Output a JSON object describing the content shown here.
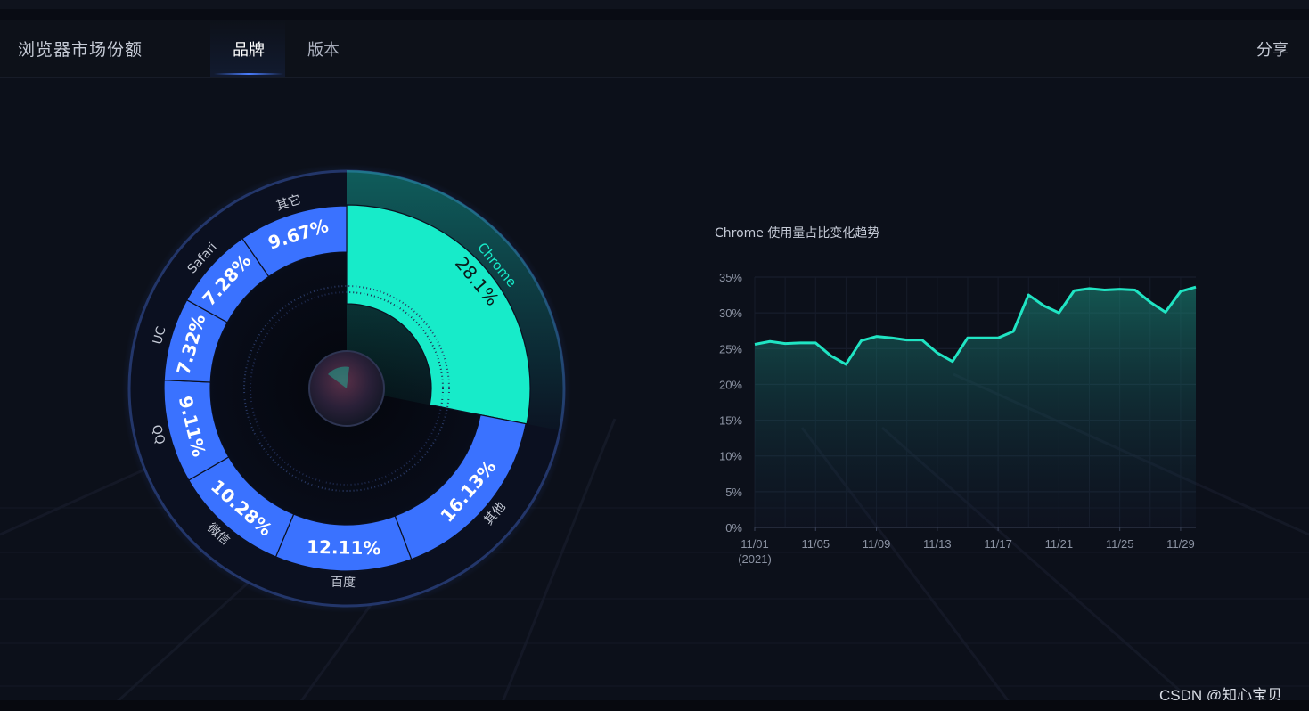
{
  "header": {
    "title": "浏览器市场份额",
    "tabs": [
      {
        "label": "品牌",
        "active": true
      },
      {
        "label": "版本",
        "active": false
      }
    ],
    "share_label": "分享"
  },
  "colors": {
    "background": "#0c101a",
    "donut_slice": "#3a72ff",
    "highlight_slice": "#17ebc9",
    "trend_line": "#20e4c3",
    "label_text": "#c5cad6"
  },
  "chart_data": [
    {
      "type": "pie",
      "variant": "donut",
      "highlighted": "Chrome",
      "slices": [
        {
          "name": "Chrome",
          "value": 28.1,
          "label": "28.1%"
        },
        {
          "name": "其他",
          "value": 16.13,
          "label": "16.13%"
        },
        {
          "name": "百度",
          "value": 12.11,
          "label": "12.11%"
        },
        {
          "name": "微信",
          "value": 10.28,
          "label": "10.28%"
        },
        {
          "name": "QQ",
          "value": 9.11,
          "label": "9.11%"
        },
        {
          "name": "UC",
          "value": 7.32,
          "label": "7.32%"
        },
        {
          "name": "Safari",
          "value": 7.28,
          "label": "7.28%"
        },
        {
          "name": "其它",
          "value": 9.67,
          "label": "9.67%"
        }
      ]
    },
    {
      "type": "area",
      "title": "Chrome 使用量占比变化趋势",
      "x": [
        "11/01",
        "11/02",
        "11/03",
        "11/04",
        "11/05",
        "11/06",
        "11/07",
        "11/08",
        "11/09",
        "11/10",
        "11/11",
        "11/12",
        "11/13",
        "11/14",
        "11/15",
        "11/16",
        "11/17",
        "11/18",
        "11/19",
        "11/20",
        "11/21",
        "11/22",
        "11/23",
        "11/24",
        "11/25",
        "11/26",
        "11/27",
        "11/28",
        "11/29",
        "11/30"
      ],
      "xtick_labels": [
        "11/01",
        "11/05",
        "11/09",
        "11/13",
        "11/17",
        "11/21",
        "11/25",
        "11/29"
      ],
      "x_year_label": "(2021)",
      "ylim": [
        0,
        35
      ],
      "yticks": [
        0,
        5,
        10,
        15,
        20,
        25,
        30,
        35
      ],
      "ytick_labels": [
        "0%",
        "5%",
        "10%",
        "15%",
        "20%",
        "25%",
        "30%",
        "35%"
      ],
      "grid": true,
      "legend": "none",
      "series": [
        {
          "values": [
            25.6,
            26.0,
            25.7,
            25.8,
            25.8,
            24.0,
            22.8,
            26.1,
            26.7,
            26.5,
            26.2,
            26.2,
            24.4,
            23.2,
            26.5,
            26.5,
            26.5,
            27.4,
            32.5,
            31.0,
            30.0,
            33.1,
            33.4,
            33.2,
            33.3,
            33.2,
            31.5,
            30.1,
            33.0,
            33.6
          ]
        }
      ]
    }
  ],
  "watermark": "CSDN @知心宝贝"
}
